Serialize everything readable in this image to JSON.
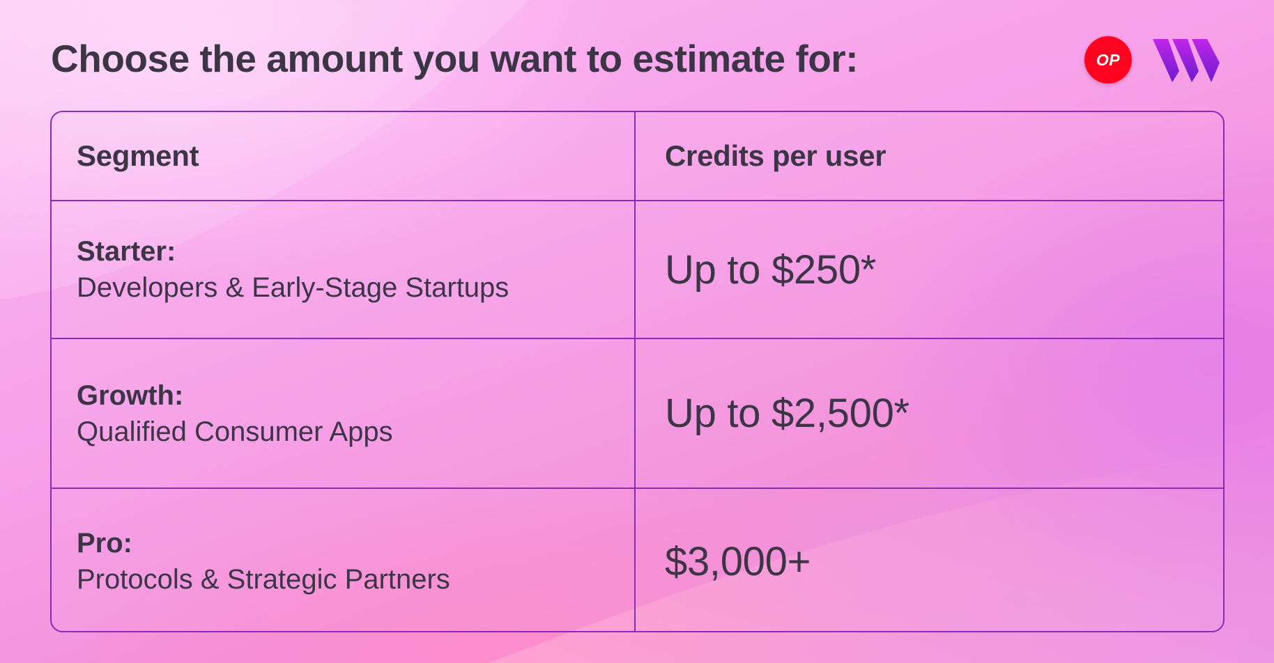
{
  "title": "Choose the amount you want to estimate for:",
  "logos": {
    "op_text": "OP",
    "op_color": "#ff0420",
    "w_colors": [
      "#a020f0",
      "#7a1fd6"
    ]
  },
  "table": {
    "headers": {
      "segment": "Segment",
      "credits": "Credits per user"
    },
    "rows": [
      {
        "segment_name": "Starter:",
        "segment_desc": "Developers & Early-Stage Startups",
        "credits": "Up to $250*"
      },
      {
        "segment_name": "Growth:",
        "segment_desc": "Qualified Consumer Apps",
        "credits": "Up to $2,500*"
      },
      {
        "segment_name": "Pro:",
        "segment_desc": "Protocols & Strategic Partners",
        "credits": "$3,000+"
      }
    ]
  },
  "colors": {
    "text": "#3b3546",
    "border": "#8a2bb8",
    "background": "#f7a2ea"
  }
}
